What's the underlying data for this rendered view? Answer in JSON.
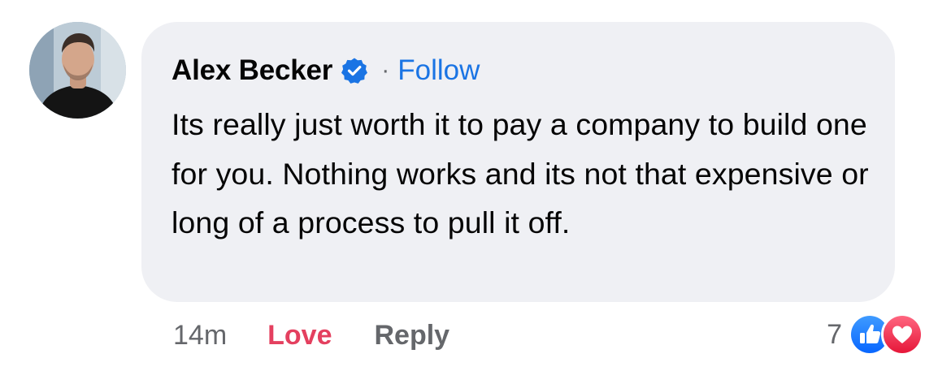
{
  "comment": {
    "author": "Alex Becker",
    "verified": true,
    "separator": "·",
    "follow_label": "Follow",
    "text": "Its really just worth it to pay a company to build one for you. Nothing works and its not that expensive or long of a process to pull it off."
  },
  "actions": {
    "time": "14m",
    "love_label": "Love",
    "reply_label": "Reply"
  },
  "reactions": {
    "count": "7",
    "types": [
      "like-icon",
      "heart-icon"
    ]
  },
  "colors": {
    "bubble": "#eff0f4",
    "follow": "#1a74e4",
    "love": "#e4405f",
    "verified": "#1a74e4",
    "like": "#1877f2",
    "heart": "#f33e58",
    "muted": "#65676b"
  }
}
